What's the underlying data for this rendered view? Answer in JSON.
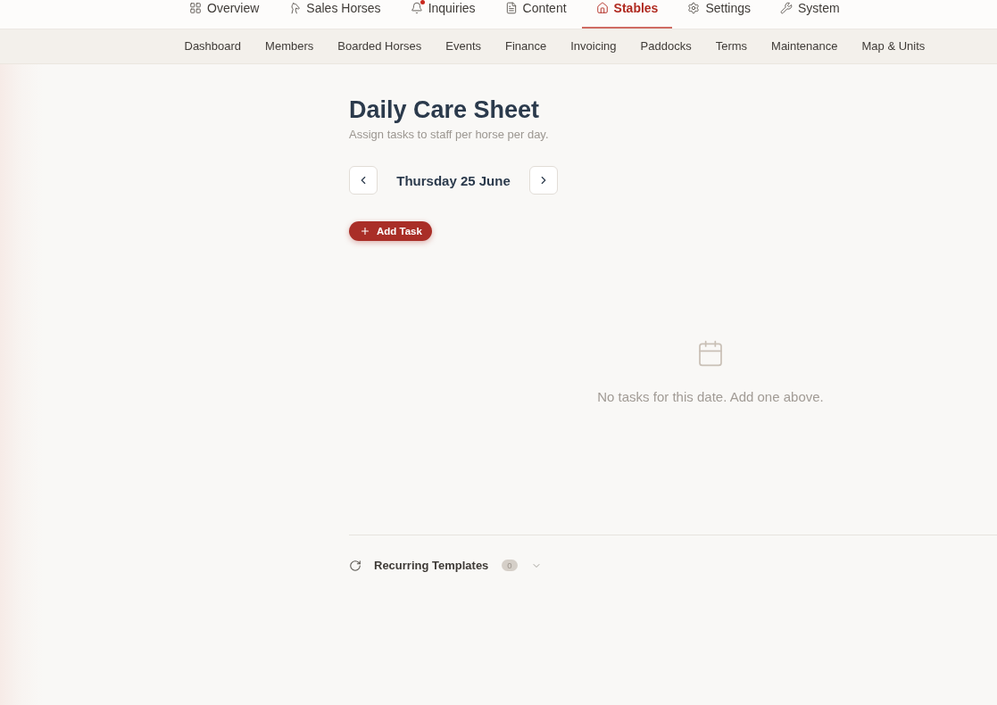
{
  "top_nav": [
    {
      "label": "Overview",
      "selected": false,
      "alert": false
    },
    {
      "label": "Sales Horses",
      "selected": false,
      "alert": false
    },
    {
      "label": "Inquiries",
      "selected": false,
      "alert": true
    },
    {
      "label": "Content",
      "selected": false,
      "alert": false
    },
    {
      "label": "Stables",
      "selected": true,
      "alert": false
    },
    {
      "label": "Settings",
      "selected": false,
      "alert": false
    },
    {
      "label": "System",
      "selected": false,
      "alert": false
    }
  ],
  "sub_nav": [
    {
      "label": "Dashboard",
      "selected": false
    },
    {
      "label": "Members",
      "selected": false
    },
    {
      "label": "Boarded Horses",
      "selected": false
    },
    {
      "label": "Events",
      "selected": false
    },
    {
      "label": "Finance",
      "selected": false
    },
    {
      "label": "Invoicing",
      "selected": false
    },
    {
      "label": "Paddocks",
      "selected": false
    },
    {
      "label": "Terms",
      "selected": false
    },
    {
      "label": "Maintenance",
      "selected": false
    },
    {
      "label": "Map & Units",
      "selected": false
    }
  ],
  "page": {
    "title": "Daily Care Sheet",
    "subtitle": "Assign tasks to staff per horse per day."
  },
  "date_nav": {
    "date": "Thursday 25 June"
  },
  "add_task_button": {
    "label": "Add Task"
  },
  "empty_state": {
    "message": "No tasks for this date. Add one above."
  },
  "recurring_templates": {
    "title": "Recurring Templates",
    "count": "0",
    "expanded": false
  }
}
